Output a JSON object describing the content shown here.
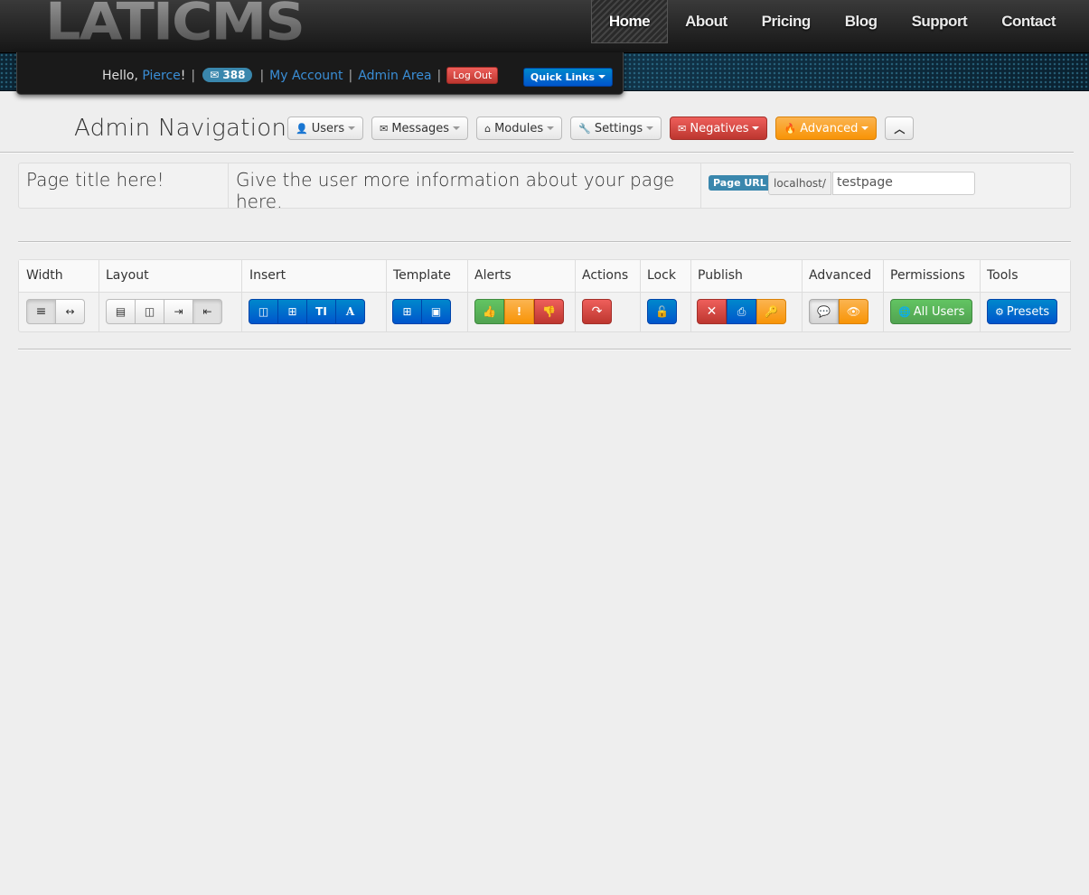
{
  "header": {
    "logo": "LATICMS",
    "nav": [
      "Home",
      "About",
      "Pricing",
      "Blog",
      "Support",
      "Contact"
    ]
  },
  "user_panel": {
    "greeting": "Hello, ",
    "username": "Pierce",
    "exclaim": "!",
    "mail_count": "388",
    "my_account": "My Account",
    "admin_area": "Admin Area",
    "logout": "Log Out",
    "quick_links": "Quick Links"
  },
  "admin_nav": {
    "title": "Admin Navigation",
    "buttons": {
      "users": "Users",
      "messages": "Messages",
      "modules": "Modules",
      "settings": "Settings",
      "negatives": "Negatives",
      "advanced": "Advanced"
    }
  },
  "page_info": {
    "title": "Page title here!",
    "description": "Give the user more information about your page here.",
    "url_label": "Page URL",
    "url_prefix": "localhost/",
    "url_value": "testpage"
  },
  "toolbar": {
    "headers": [
      "Width",
      "Layout",
      "Insert",
      "Template",
      "Alerts",
      "Actions",
      "Lock",
      "Publish",
      "Advanced",
      "Permissions",
      "Tools"
    ],
    "permissions_button": "All Users",
    "tools_button": "Presets"
  },
  "colors": {
    "primary": "#0077cc",
    "success": "#51a351",
    "warning": "#f89406",
    "danger": "#bd362f",
    "info": "#3a87ad"
  }
}
